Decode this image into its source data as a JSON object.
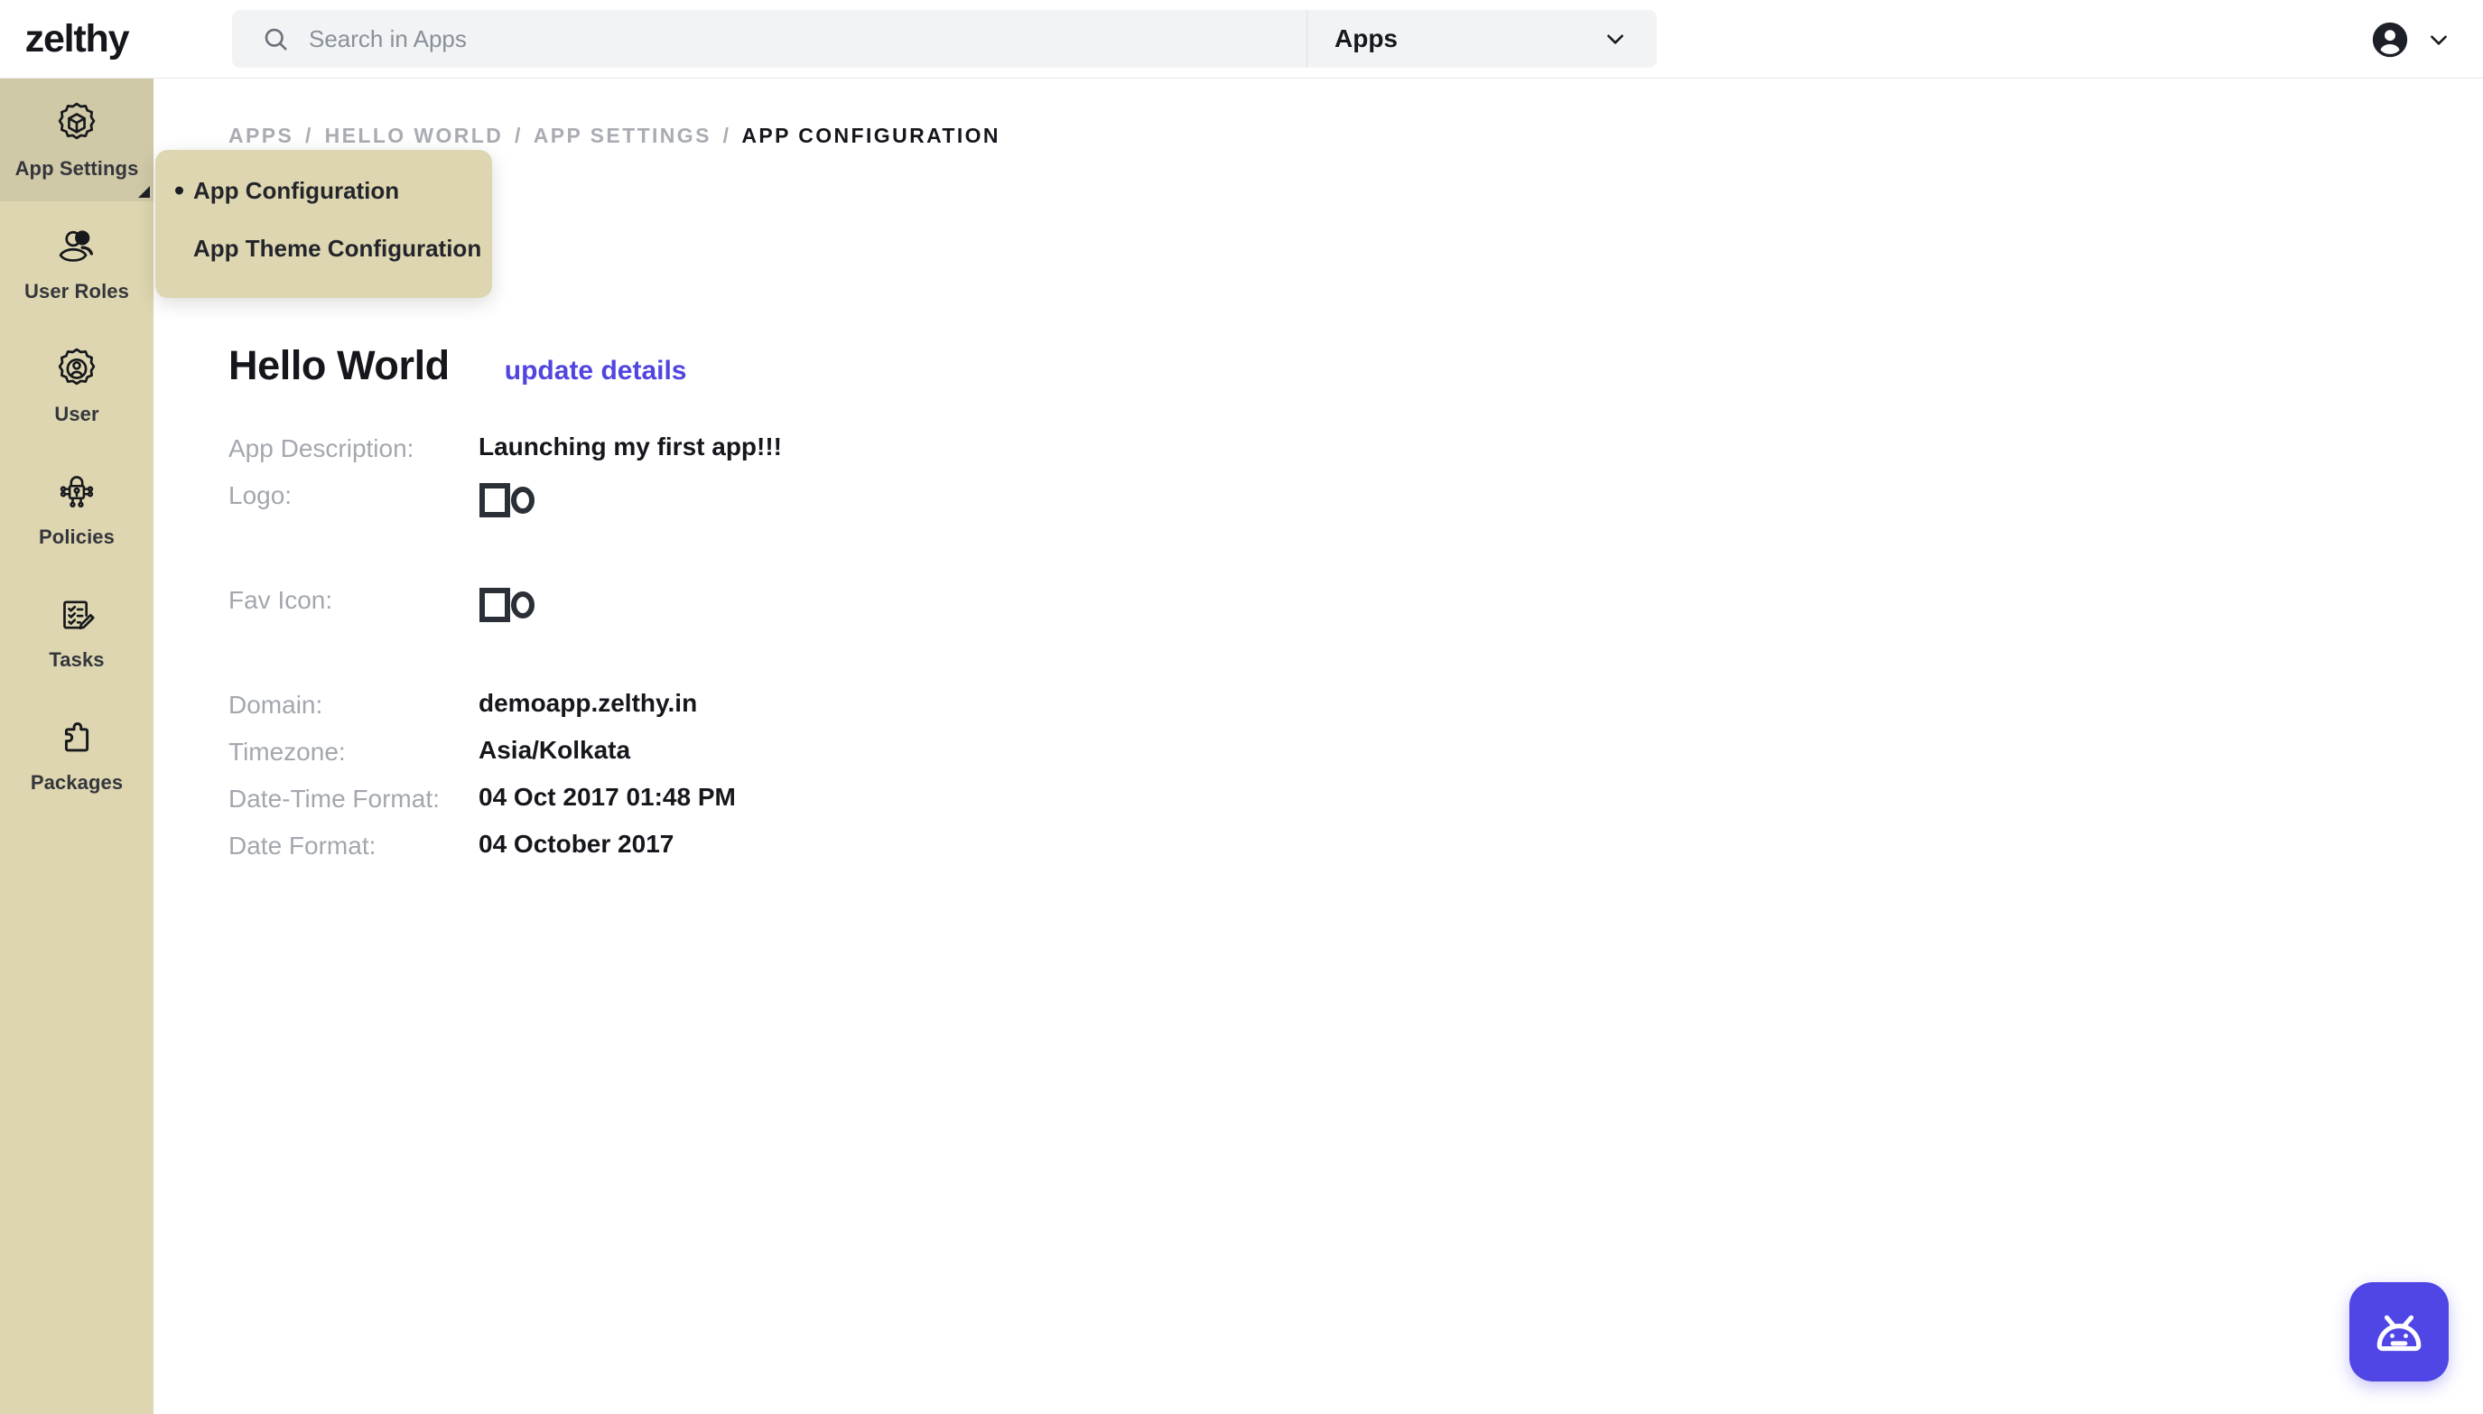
{
  "brand": {
    "name": "zelthy"
  },
  "search": {
    "placeholder": "Search in Apps",
    "value": "",
    "icon": "search-icon",
    "scope_label": "Apps",
    "scope_icon": "chevron-down-icon"
  },
  "user_menu": {
    "avatar_icon": "account-circle-icon",
    "caret_icon": "chevron-down-icon"
  },
  "sidebar": {
    "items": [
      {
        "label": "App Settings",
        "icon": "gear-cube-icon",
        "active": true
      },
      {
        "label": "User Roles",
        "icon": "users-group-icon",
        "active": false
      },
      {
        "label": "User",
        "icon": "gear-user-icon",
        "active": false
      },
      {
        "label": "Policies",
        "icon": "lock-network-icon",
        "active": false
      },
      {
        "label": "Tasks",
        "icon": "checklist-pencil-icon",
        "active": false
      },
      {
        "label": "Packages",
        "icon": "puzzle-piece-icon",
        "active": false
      }
    ]
  },
  "flyout": {
    "items": [
      {
        "label": "App Configuration",
        "current": true
      },
      {
        "label": "App Theme Configuration",
        "current": false
      }
    ]
  },
  "breadcrumb": {
    "items": [
      {
        "label": "APPS",
        "current": false
      },
      {
        "label": "HELLO WORLD",
        "current": false
      },
      {
        "label": "APP SETTINGS",
        "current": false
      },
      {
        "label": "APP CONFIGURATION",
        "current": true
      }
    ],
    "separator": "/"
  },
  "page": {
    "title": "Hello World",
    "update_link": "update details"
  },
  "details": [
    {
      "label": "App Description:",
      "value": "Launching my first app!!!",
      "type": "text"
    },
    {
      "label": "Logo:",
      "value": "",
      "type": "image",
      "image_state": "broken-image"
    },
    {
      "label": "Fav Icon:",
      "value": "",
      "type": "image",
      "image_state": "broken-image"
    },
    {
      "label": "Domain:",
      "value": "demoapp.zelthy.in",
      "type": "text"
    },
    {
      "label": "Timezone:",
      "value": "Asia/Kolkata",
      "type": "text"
    },
    {
      "label": "Date-Time Format:",
      "value": "04 Oct 2017 01:48 PM",
      "type": "text"
    },
    {
      "label": "Date Format:",
      "value": "04 October 2017",
      "type": "text"
    }
  ],
  "chat": {
    "icon": "robot-icon"
  },
  "colors": {
    "sidebar_bg": "#ddd6b0",
    "sidebar_active_bg": "#d0c9a8",
    "link_accent": "#5145e0",
    "chat_accent": "#4f46e5",
    "label_muted": "#a3a7ae",
    "text_primary": "#15171d"
  }
}
